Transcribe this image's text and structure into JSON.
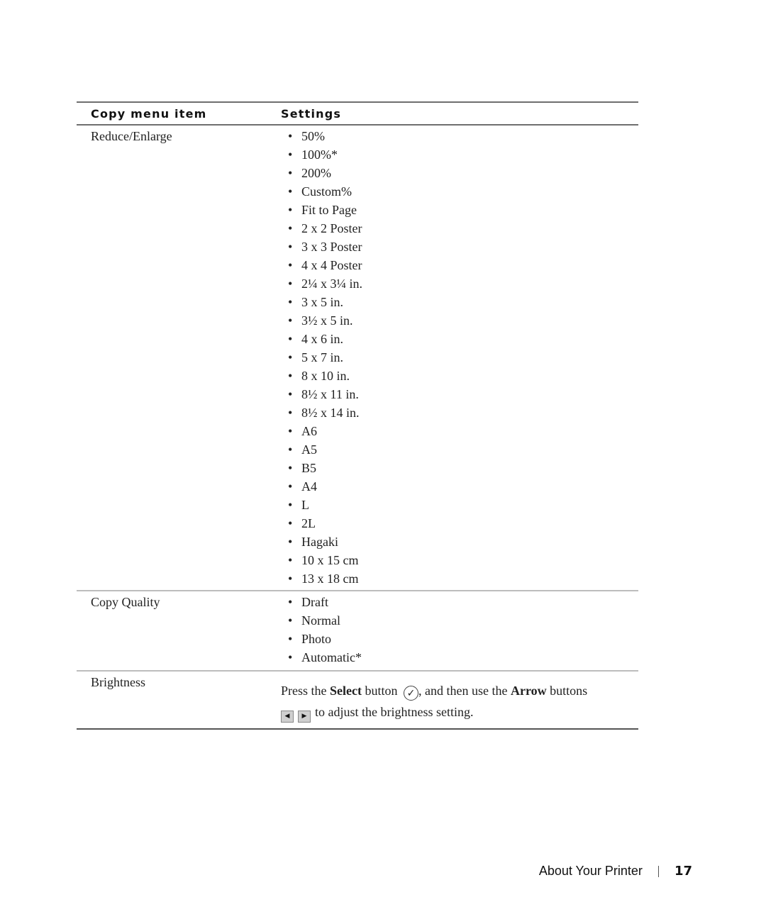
{
  "table": {
    "headers": [
      "Copy menu item",
      "Settings"
    ],
    "rows": [
      {
        "item": "Reduce/Enlarge",
        "settings": [
          "50%",
          "100%*",
          "200%",
          "Custom%",
          "Fit to Page",
          "2 x 2 Poster",
          "3 x 3 Poster",
          "4 x 4 Poster",
          "2¼ x 3¼ in.",
          "3 x 5 in.",
          "3½ x 5 in.",
          "4 x 6 in.",
          "5 x 7 in.",
          "8 x 10 in.",
          "8½ x 11 in.",
          "8½ x 14 in.",
          "A6",
          "A5",
          "B5",
          "A4",
          "L",
          "2L",
          "Hagaki",
          "10 x 15 cm",
          "13 x 18 cm"
        ]
      },
      {
        "item": "Copy Quality",
        "settings": [
          "Draft",
          "Normal",
          "Photo",
          "Automatic*"
        ]
      },
      {
        "item": "Brightness",
        "text": {
          "part1": "Press the ",
          "bold1": "Select",
          "part2": " button ",
          "select_icon": "✓",
          "part3": ", and then use the ",
          "bold2": "Arrow",
          "part4": " buttons",
          "left_arrow": "◀",
          "right_arrow": "▶",
          "part5": "to adjust the brightness setting."
        }
      }
    ]
  },
  "footer": {
    "section": "About Your Printer",
    "page": "17"
  }
}
